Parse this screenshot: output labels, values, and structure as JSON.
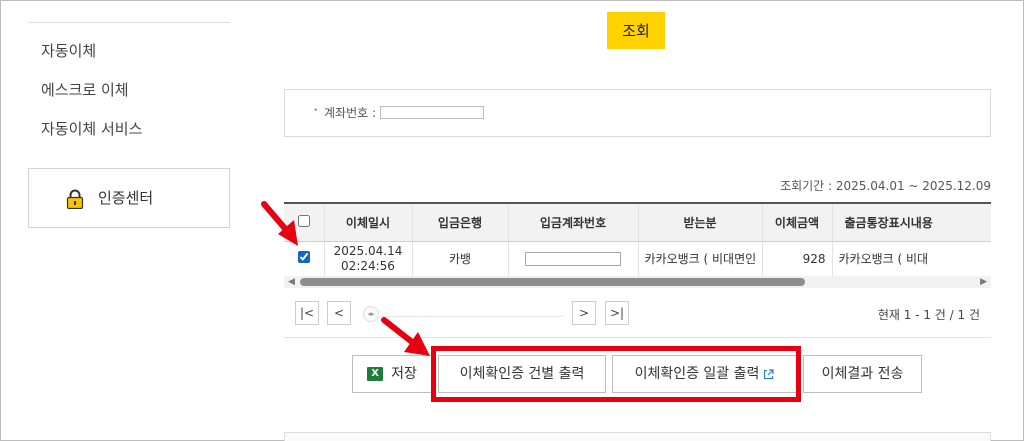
{
  "sidebar": {
    "items": [
      {
        "label": "자동이체"
      },
      {
        "label": "에스크로 이체"
      },
      {
        "label": "자동이체 서비스"
      }
    ],
    "cert_center": {
      "label": "인증센터",
      "icon": "lock-icon"
    }
  },
  "query_button": {
    "label": "조회",
    "color": "#ffd200"
  },
  "search": {
    "bullet": "•",
    "account_label": "계좌번호 :",
    "account_value": ""
  },
  "period": {
    "text": "조회기간 : 2025.04.01 ~ 2025.12.09"
  },
  "table": {
    "headers": [
      "",
      "이체일시",
      "입금은행",
      "입금계좌번호",
      "받는분",
      "이체금액",
      "출금통장표시내용"
    ],
    "rows": [
      {
        "checked": true,
        "date": "2025.04.14",
        "time": "02:24:56",
        "bank": "카뱅",
        "account": "",
        "recipient": "카카오뱅크 ( 비대면인",
        "amount": "928",
        "memo": "카카오뱅크 ( 비대"
      }
    ]
  },
  "pager": {
    "first": "|<",
    "prev": "<",
    "next": ">",
    "last": ">|",
    "slider_knob": "◂▸",
    "info": "현재 1 - 1 건 / 1 건"
  },
  "actions": {
    "save": {
      "label": "저장",
      "icon": "excel-icon",
      "icon_text": "X"
    },
    "print_single": {
      "label": "이체확인증 건별 출력"
    },
    "print_batch": {
      "label": "이체확인증 일괄 출력",
      "icon": "external-link-icon"
    },
    "send_result": {
      "label": "이체결과 전송"
    }
  },
  "colors": {
    "highlight": "#e60012",
    "accent": "#ffd200"
  }
}
